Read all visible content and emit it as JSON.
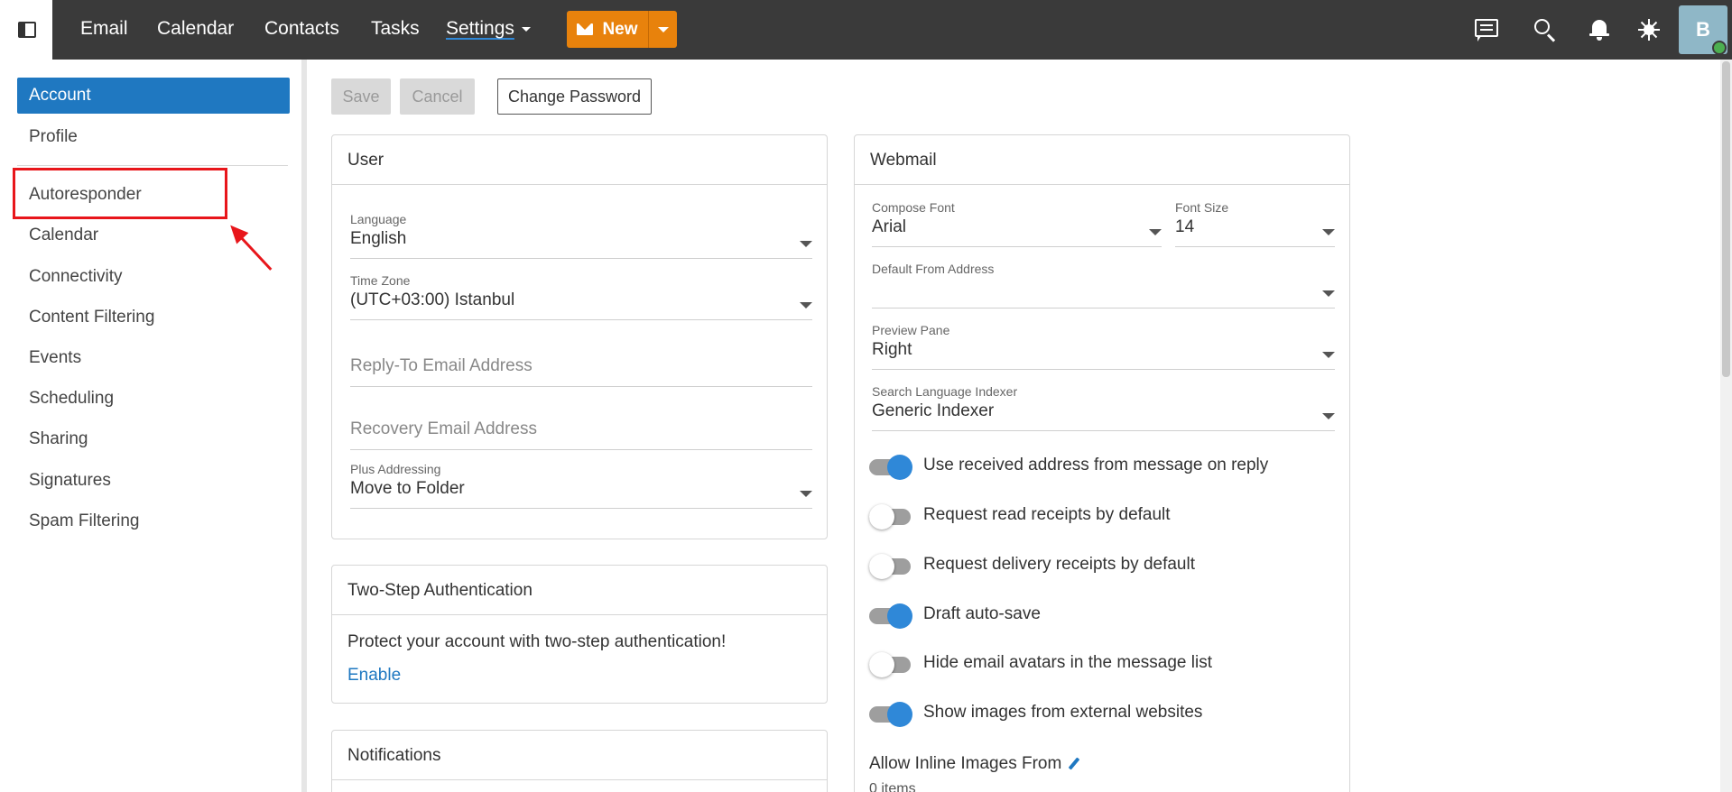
{
  "nav": {
    "email": "Email",
    "calendar": "Calendar",
    "contacts": "Contacts",
    "tasks": "Tasks",
    "settings": "Settings",
    "new_label": "New",
    "avatar_initial": "B"
  },
  "sidebar": {
    "items": [
      "Account",
      "Profile",
      "Autoresponder",
      "Calendar",
      "Connectivity",
      "Content Filtering",
      "Events",
      "Scheduling",
      "Sharing",
      "Signatures",
      "Spam Filtering"
    ]
  },
  "toolbar": {
    "save": "Save",
    "cancel": "Cancel",
    "change_password": "Change Password"
  },
  "user_panel": {
    "title": "User",
    "language_label": "Language",
    "language_value": "English",
    "timezone_label": "Time Zone",
    "timezone_value": "(UTC+03:00) Istanbul",
    "reply_to_placeholder": "Reply-To Email Address",
    "recovery_placeholder": "Recovery Email Address",
    "plus_label": "Plus Addressing",
    "plus_value": "Move to Folder"
  },
  "twostep_panel": {
    "title": "Two-Step Authentication",
    "text": "Protect your account with two-step authentication!",
    "enable": "Enable"
  },
  "notifications_panel": {
    "title": "Notifications"
  },
  "webmail_panel": {
    "title": "Webmail",
    "compose_font_label": "Compose Font",
    "compose_font_value": "Arial",
    "font_size_label": "Font Size",
    "font_size_value": "14",
    "default_from_label": "Default From Address",
    "preview_label": "Preview Pane",
    "preview_value": "Right",
    "search_label": "Search Language Indexer",
    "search_value": "Generic Indexer",
    "toggles": [
      {
        "label": "Use received address from message on reply",
        "on": true
      },
      {
        "label": "Request read receipts by default",
        "on": false
      },
      {
        "label": "Request delivery receipts by default",
        "on": false
      },
      {
        "label": "Draft auto-save",
        "on": true
      },
      {
        "label": "Hide email avatars in the message list",
        "on": false
      },
      {
        "label": "Show images from external websites",
        "on": true
      }
    ],
    "allow_inline_label": "Allow Inline Images From",
    "items_count": "0 items"
  },
  "colors": {
    "topbar": "#3a3a3a",
    "accent": "#1f78c1",
    "new_button": "#e8820c",
    "annotation_red": "#e8161b",
    "toggle_on": "#2f88d8"
  }
}
